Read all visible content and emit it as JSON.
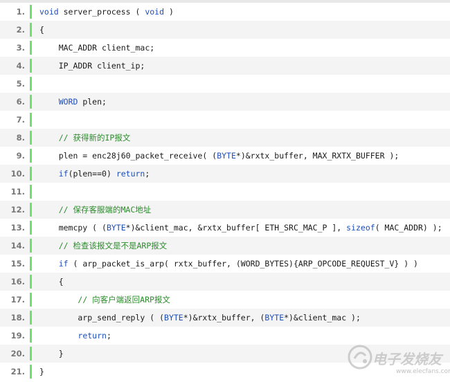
{
  "code": {
    "lines": [
      {
        "num": "1.",
        "parts": [
          {
            "t": "void",
            "c": "kw"
          },
          {
            "t": " server_process ( "
          },
          {
            "t": "void",
            "c": "kw"
          },
          {
            "t": " )"
          }
        ]
      },
      {
        "num": "2.",
        "parts": [
          {
            "t": "{"
          }
        ]
      },
      {
        "num": "3.",
        "parts": [
          {
            "t": "    MAC_ADDR client_mac;"
          }
        ]
      },
      {
        "num": "4.",
        "parts": [
          {
            "t": "    IP_ADDR client_ip;"
          }
        ]
      },
      {
        "num": "5.",
        "parts": []
      },
      {
        "num": "6.",
        "parts": [
          {
            "t": "    "
          },
          {
            "t": "WORD",
            "c": "kw"
          },
          {
            "t": " plen;"
          }
        ]
      },
      {
        "num": "7.",
        "parts": []
      },
      {
        "num": "8.",
        "parts": [
          {
            "t": "    "
          },
          {
            "t": "// 获得新的IP报文",
            "c": "cm"
          }
        ]
      },
      {
        "num": "9.",
        "parts": [
          {
            "t": "    plen = enc28j60_packet_receive( ("
          },
          {
            "t": "BYTE",
            "c": "kw"
          },
          {
            "t": "*)&rxtx_buffer, MAX_RXTX_BUFFER );"
          }
        ]
      },
      {
        "num": "10.",
        "parts": [
          {
            "t": "    "
          },
          {
            "t": "if",
            "c": "kw"
          },
          {
            "t": "(plen==0) "
          },
          {
            "t": "return",
            "c": "kw"
          },
          {
            "t": ";"
          }
        ]
      },
      {
        "num": "11.",
        "parts": []
      },
      {
        "num": "12.",
        "parts": [
          {
            "t": "    "
          },
          {
            "t": "// 保存客服端的MAC地址",
            "c": "cm"
          }
        ]
      },
      {
        "num": "13.",
        "parts": [
          {
            "t": "    memcpy ( ("
          },
          {
            "t": "BYTE",
            "c": "kw"
          },
          {
            "t": "*)&client_mac, &rxtx_buffer[ ETH_SRC_MAC_P ], "
          },
          {
            "t": "sizeof",
            "c": "kw"
          },
          {
            "t": "( MAC_ADDR) );"
          }
        ]
      },
      {
        "num": "14.",
        "parts": [
          {
            "t": "    "
          },
          {
            "t": "// 检查该报文是不是ARP报文",
            "c": "cm"
          }
        ]
      },
      {
        "num": "15.",
        "parts": [
          {
            "t": "    "
          },
          {
            "t": "if",
            "c": "kw"
          },
          {
            "t": " ( arp_packet_is_arp( rxtx_buffer, (WORD_BYTES){ARP_OPCODE_REQUEST_V} ) )"
          }
        ]
      },
      {
        "num": "16.",
        "parts": [
          {
            "t": "    {"
          }
        ]
      },
      {
        "num": "17.",
        "parts": [
          {
            "t": "        "
          },
          {
            "t": "// 向客户端返回ARP报文",
            "c": "cm"
          }
        ]
      },
      {
        "num": "18.",
        "parts": [
          {
            "t": "        arp_send_reply ( ("
          },
          {
            "t": "BYTE",
            "c": "kw"
          },
          {
            "t": "*)&rxtx_buffer, ("
          },
          {
            "t": "BYTE",
            "c": "kw"
          },
          {
            "t": "*)&client_mac );"
          }
        ]
      },
      {
        "num": "19.",
        "parts": [
          {
            "t": "        "
          },
          {
            "t": "return",
            "c": "kw"
          },
          {
            "t": ";"
          }
        ]
      },
      {
        "num": "20.",
        "parts": [
          {
            "t": "    }"
          }
        ]
      },
      {
        "num": "21.",
        "parts": [
          {
            "t": "}"
          }
        ]
      }
    ]
  },
  "watermark": {
    "text": "电子发烧友",
    "url": "www.elecfans.com"
  },
  "colors": {
    "keyword": "#1e4eb8",
    "comment": "#2c8a2c",
    "marker": "#6ce26c",
    "line_number": "#777777"
  }
}
